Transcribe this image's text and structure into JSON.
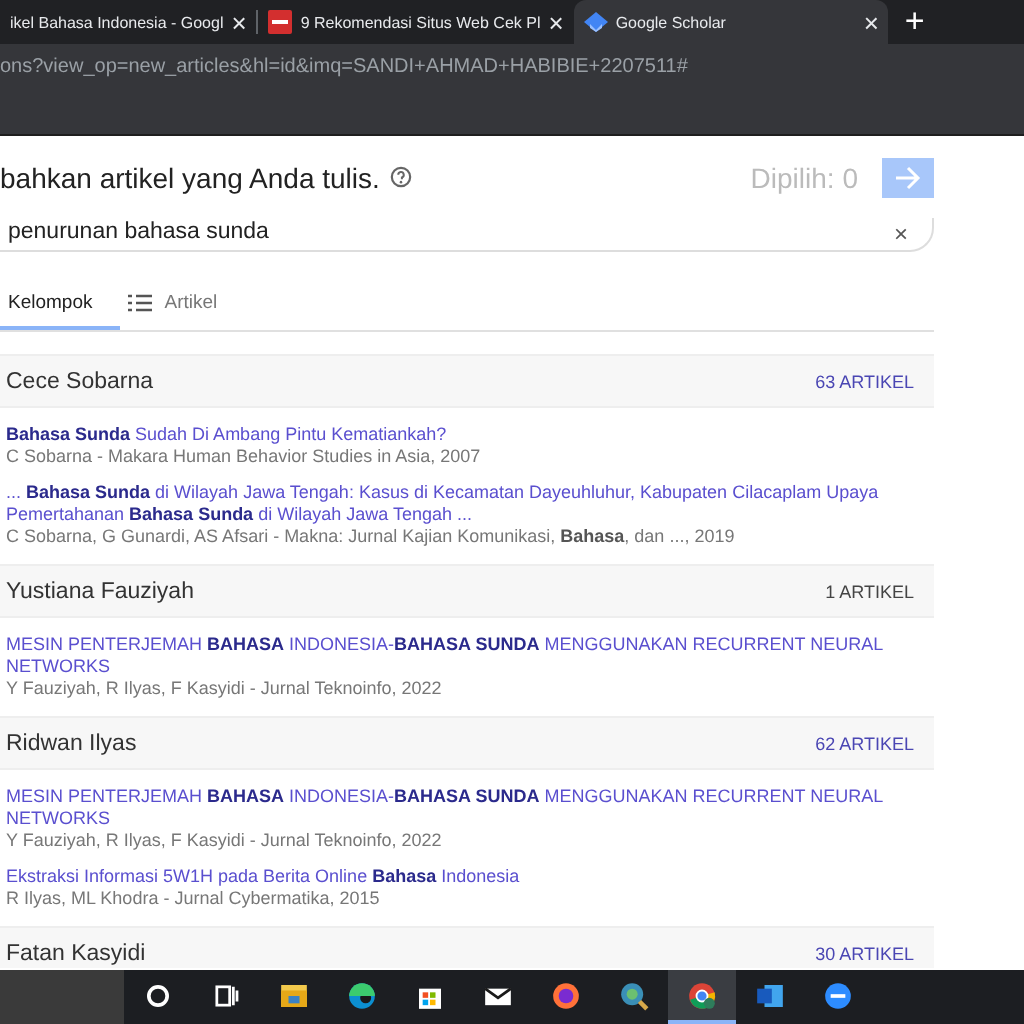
{
  "browser": {
    "tabs": [
      {
        "title": "ikel Bahasa Indonesia - Googl",
        "selected": false
      },
      {
        "title": "9 Rekomendasi Situs Web Cek Pl",
        "kind": "news",
        "selected": false
      },
      {
        "title": "Google Scholar",
        "kind": "scholar",
        "selected": true
      }
    ],
    "new_tab": "+",
    "close": "×",
    "address": "ons?view_op=new_articles&hl=id&imq=SANDI+AHMAD+HABIBIE+2207511#"
  },
  "dialog": {
    "heading": "bahkan artikel yang Anda tulis.",
    "selected_count": "Dipilih: 0",
    "search": {
      "value": "penurunan bahasa sunda",
      "clear": "×"
    },
    "view_tabs": [
      {
        "label": "Kelompok",
        "selected": true
      },
      {
        "label": "Artikel",
        "selected": false
      }
    ],
    "groups": [
      {
        "name": "Cece Sobarna",
        "count": "63 ARTIKEL",
        "count_emphasis": true,
        "articles": [
          {
            "title": "**Bahasa Sunda** Sudah Di Ambang Pintu Kematiankah?",
            "meta": "C Sobarna - Makara Human Behavior Studies in Asia, 2007"
          },
          {
            "title": "... **Bahasa Sunda** di Wilayah Jawa Tengah: Kasus di Kecamatan Dayeuhluhur, Kabupaten Cilacaplam Upaya Pemertahanan **Bahasa Sunda** di Wilayah Jawa Tengah ...",
            "meta": "C Sobarna, G Gunardi, AS Afsari - Makna: Jurnal Kajian Komunikasi, **Bahasa**, dan ..., 2019"
          }
        ]
      },
      {
        "name": "Yustiana Fauziyah",
        "count": "1 ARTIKEL",
        "count_emphasis": false,
        "articles": [
          {
            "title": "MESIN PENTERJEMAH **BAHASA** INDONESIA-**BAHASA SUNDA** MENGGUNAKAN RECURRENT NEURAL NETWORKS",
            "meta": "Y Fauziyah, R Ilyas, F Kasyidi - Jurnal Teknoinfo, 2022"
          }
        ]
      },
      {
        "name": "Ridwan Ilyas",
        "count": "62 ARTIKEL",
        "count_emphasis": true,
        "articles": [
          {
            "title": "MESIN PENTERJEMAH **BAHASA** INDONESIA-**BAHASA SUNDA** MENGGUNAKAN RECURRENT NEURAL NETWORKS",
            "meta": "Y Fauziyah, R Ilyas, F Kasyidi - Jurnal Teknoinfo, 2022"
          },
          {
            "title": "Ekstraksi Informasi 5W1H pada Berita Online **Bahasa** Indonesia",
            "meta": "R Ilyas, ML Khodra - Jurnal Cybermatika, 2015"
          }
        ]
      },
      {
        "name": "Fatan Kasyidi",
        "count": "30 ARTIKEL",
        "count_emphasis": true
      }
    ]
  },
  "taskbar": {
    "apps": [
      {
        "kind": "cortana",
        "selected": false
      },
      {
        "kind": "taskview",
        "selected": false
      },
      {
        "kind": "folder",
        "selected": false
      },
      {
        "kind": "edge",
        "selected": false
      },
      {
        "kind": "store",
        "selected": false
      },
      {
        "kind": "mail",
        "selected": false
      },
      {
        "kind": "firefox",
        "selected": false
      },
      {
        "kind": "magnifier",
        "selected": false
      },
      {
        "kind": "chrome",
        "selected": true
      },
      {
        "kind": "word",
        "selected": false
      },
      {
        "kind": "zoom",
        "selected": false
      }
    ]
  }
}
